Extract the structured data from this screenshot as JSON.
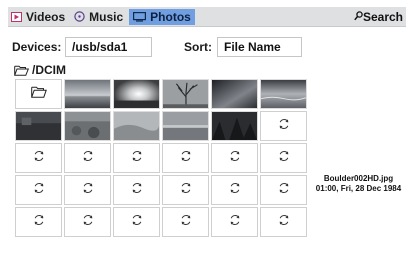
{
  "tabs": [
    {
      "label": "Videos",
      "icon": "video-icon"
    },
    {
      "label": "Music",
      "icon": "music-icon"
    },
    {
      "label": "Photos",
      "icon": "photos-icon",
      "active": true
    }
  ],
  "search": {
    "label": "Search",
    "icon": "search-icon"
  },
  "filters": {
    "devices_label": "Devices:",
    "devices_value": "/usb/sda1",
    "sort_label": "Sort:",
    "sort_value": "File Name"
  },
  "path": {
    "label": "/DCIM",
    "icon": "folder-open-icon"
  },
  "grid": {
    "cells": [
      {
        "type": "folder",
        "icon": "folder-up-icon"
      },
      {
        "type": "thumb",
        "scene": "sky-horizon"
      },
      {
        "type": "thumb",
        "scene": "sun-glow"
      },
      {
        "type": "thumb",
        "scene": "bare-tree"
      },
      {
        "type": "thumb",
        "scene": "dark-clouds"
      },
      {
        "type": "thumb",
        "scene": "stormy-sea"
      },
      {
        "type": "thumb",
        "scene": "dark-landscape"
      },
      {
        "type": "thumb",
        "scene": "rocky-field"
      },
      {
        "type": "thumb",
        "scene": "foggy-hills"
      },
      {
        "type": "thumb",
        "scene": "grey-water"
      },
      {
        "type": "thumb",
        "scene": "dark-trees"
      },
      {
        "type": "loading",
        "icon": "loading-icon"
      },
      {
        "type": "loading",
        "icon": "loading-icon"
      },
      {
        "type": "loading",
        "icon": "loading-icon"
      },
      {
        "type": "loading",
        "icon": "loading-icon"
      },
      {
        "type": "loading",
        "icon": "loading-icon"
      },
      {
        "type": "loading",
        "icon": "loading-icon"
      },
      {
        "type": "loading",
        "icon": "loading-icon"
      },
      {
        "type": "loading",
        "icon": "loading-icon"
      },
      {
        "type": "loading",
        "icon": "loading-icon"
      },
      {
        "type": "loading",
        "icon": "loading-icon"
      },
      {
        "type": "loading",
        "icon": "loading-icon"
      },
      {
        "type": "loading",
        "icon": "loading-icon"
      },
      {
        "type": "loading",
        "icon": "loading-icon"
      },
      {
        "type": "loading",
        "icon": "loading-icon"
      },
      {
        "type": "loading",
        "icon": "loading-icon"
      },
      {
        "type": "loading",
        "icon": "loading-icon"
      },
      {
        "type": "loading",
        "icon": "loading-icon"
      },
      {
        "type": "loading",
        "icon": "loading-icon"
      },
      {
        "type": "loading",
        "icon": "loading-icon"
      }
    ]
  },
  "selection": {
    "filename": "Boulder002HD.jpg",
    "datetime": "01:00, Fri, 28 Dec 1984"
  },
  "colors": {
    "active_tab": "#6f9fe0",
    "topbar": "#dfe0e2",
    "video_icon": "#c0306a"
  }
}
